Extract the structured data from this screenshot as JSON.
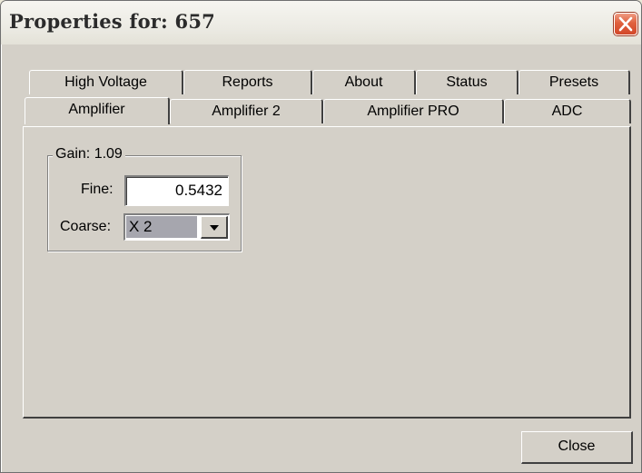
{
  "window": {
    "title": "Properties for: 657"
  },
  "tabs": {
    "row1": [
      {
        "label": "High Voltage"
      },
      {
        "label": "Reports"
      },
      {
        "label": "About"
      },
      {
        "label": "Status"
      },
      {
        "label": "Presets"
      }
    ],
    "row2": [
      {
        "label": "Amplifier",
        "active": true
      },
      {
        "label": "Amplifier 2"
      },
      {
        "label": "Amplifier PRO"
      },
      {
        "label": "ADC"
      }
    ]
  },
  "gain": {
    "legend": "Gain: 1.09",
    "fine_label": "Fine:",
    "fine_value": "0.5432",
    "coarse_label": "Coarse:",
    "coarse_value": "X 2"
  },
  "footer": {
    "close_label": "Close"
  },
  "colors": {
    "face": "#d4d0c8",
    "close_icon": "#d2482a"
  },
  "icons": {
    "close": "close-icon",
    "dropdown": "chevron-down-icon"
  }
}
